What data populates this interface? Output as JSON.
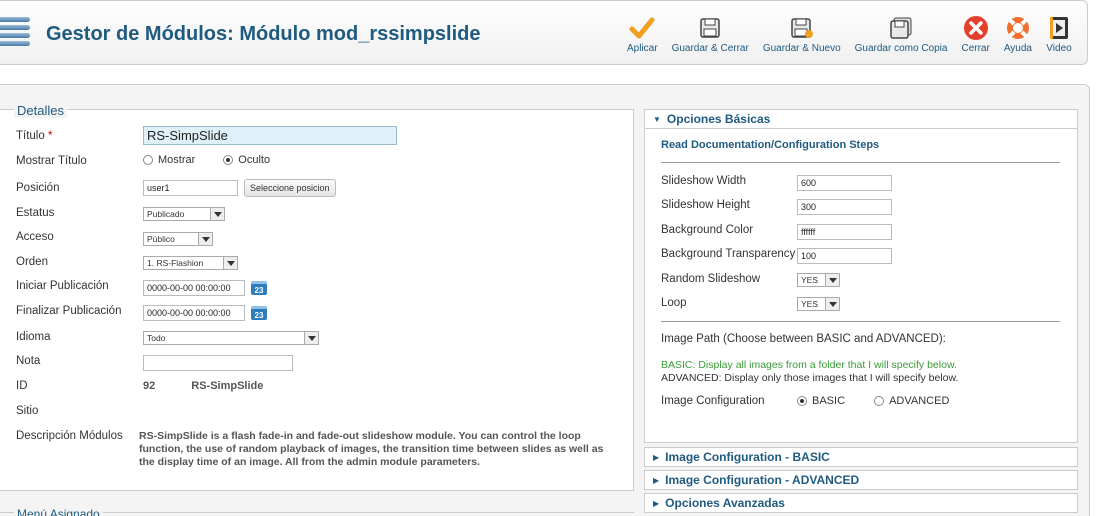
{
  "header": {
    "title": "Gestor de Módulos: Módulo mod_rssimpslide",
    "toolbar": [
      {
        "label": "Aplicar",
        "icon": "check-icon"
      },
      {
        "label": "Guardar & Cerrar",
        "icon": "save-close-icon"
      },
      {
        "label": "Guardar & Nuevo",
        "icon": "save-new-icon"
      },
      {
        "label": "Guardar como Copia",
        "icon": "save-copy-icon"
      },
      {
        "label": "Cerrar",
        "icon": "close-icon"
      },
      {
        "label": "Ayuda",
        "icon": "help-icon"
      },
      {
        "label": "Video",
        "icon": "video-icon"
      }
    ]
  },
  "details": {
    "legend": "Detalles",
    "titulo_label": "Título",
    "required_mark": "*",
    "titulo_value": "RS-SimpSlide",
    "mostrar_titulo_label": "Mostrar Título",
    "mostrar_opt": "Mostrar",
    "oculto_opt": "Oculto",
    "posicion_label": "Posición",
    "posicion_value": "user1",
    "posicion_button": "Seleccione posicion",
    "estatus_label": "Estatus",
    "estatus_value": "Publicado",
    "acceso_label": "Acceso",
    "acceso_value": "Público",
    "orden_label": "Orden",
    "orden_value": "1. RS-Flashion",
    "iniciar_label": "Iniciar Publicación",
    "iniciar_value": "0000-00-00 00:00:00",
    "finalizar_label": "Finalizar Publicación",
    "finalizar_value": "0000-00-00 00:00:00",
    "cal_day": "23",
    "idioma_label": "Idioma",
    "idioma_value": "Todo",
    "nota_label": "Nota",
    "nota_value": "",
    "id_label": "ID",
    "id_value": "92",
    "id_name": "RS-SimpSlide",
    "sitio_label": "Sitio",
    "descripcion_label": "Descripción Módulos",
    "descripcion_value": "RS-SimpSlide is a flash fade-in and fade-out slideshow module. You can control the loop function, the use of random playback of images, the transition time between slides as well as the display time of an image. All from the admin module parameters."
  },
  "menu_asignado": "Menú Asignado",
  "options": {
    "basic_header": "Opciones Básicas",
    "section_title": "Read Documentation/Configuration Steps",
    "slideshow_width_label": "Slideshow Width",
    "slideshow_width_value": "600",
    "slideshow_height_label": "Slideshow Height",
    "slideshow_height_value": "300",
    "bg_color_label": "Background Color",
    "bg_color_value": "ffffff",
    "bg_transparency_label": "Background Transparency",
    "bg_transparency_value": "100",
    "random_label": "Random Slideshow",
    "random_value": "YES",
    "loop_label": "Loop",
    "loop_value": "YES",
    "image_path_label": "Image Path (Choose between BASIC and ADVANCED):",
    "basic_note": "BASIC: Display all images from a folder that I will specify below.",
    "advanced_note": "ADVANCED: Display only those images that I will specify below.",
    "image_config_label": "Image Configuration",
    "image_config_basic": "BASIC",
    "image_config_advanced": "ADVANCED",
    "panels": [
      "Image Configuration - BASIC",
      "Image Configuration - ADVANCED",
      "Opciones Avanzadas"
    ]
  },
  "colors": {
    "accent": "#1f5a80",
    "green_note": "#3a9a3a",
    "required": "#cc0000"
  }
}
